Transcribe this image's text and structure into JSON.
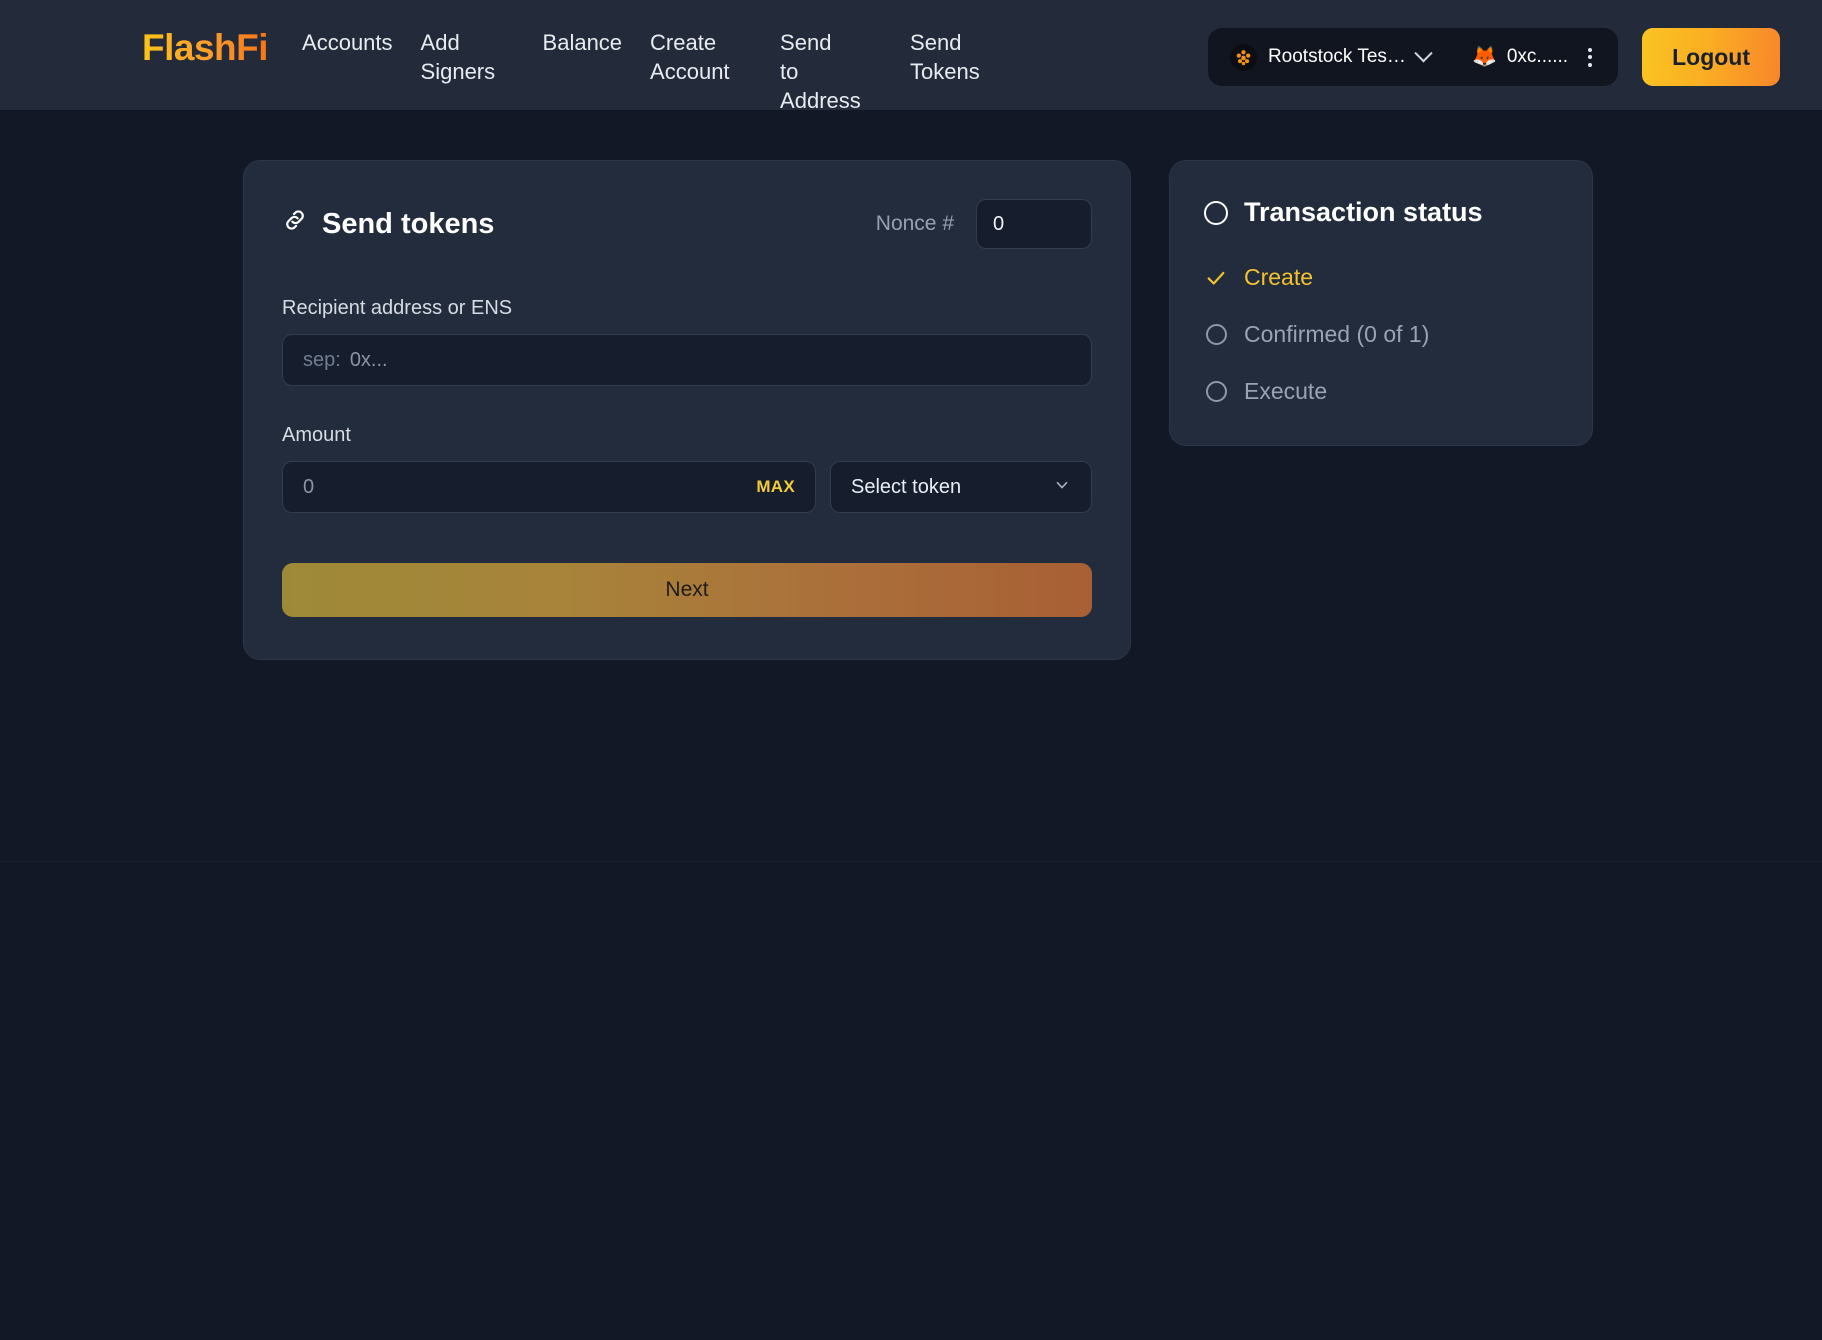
{
  "brand": {
    "name": "FlashFi"
  },
  "nav": {
    "items": [
      {
        "label": "Accounts",
        "name": "nav-item-accounts"
      },
      {
        "label": "Add Signers",
        "name": "nav-item-add-signers"
      },
      {
        "label": "Balance",
        "name": "nav-item-balance"
      },
      {
        "label": "Create Account",
        "name": "nav-item-create-account"
      },
      {
        "label": "Send to Address",
        "name": "nav-item-send-to-address"
      },
      {
        "label": "Send Tokens",
        "name": "nav-item-send-tokens"
      }
    ]
  },
  "wallet": {
    "chain_name": "Rootstock Tes…",
    "chain_icon": "rootstock-icon",
    "account_address": "0xc......",
    "account_icon": "metamask-fox-icon",
    "menu_icon": "kebab-menu-icon"
  },
  "logout": {
    "label": "Logout"
  },
  "send_card": {
    "title": "Send tokens",
    "title_icon": "link-chain-icon",
    "nonce_label": "Nonce #",
    "nonce_value": "0",
    "recipient_label": "Recipient address or ENS",
    "recipient_prefix": "sep:",
    "recipient_placeholder": "0x...",
    "recipient_value": "",
    "amount_label": "Amount",
    "amount_placeholder": "0",
    "amount_value": "",
    "max_label": "MAX",
    "token_select_label": "Select token",
    "token_chevron_icon": "chevron-down-icon",
    "next_label": "Next"
  },
  "status_panel": {
    "title": "Transaction status",
    "title_icon": "circle-outline-icon",
    "steps": [
      {
        "label": "Create",
        "state": "done",
        "icon": "check-icon"
      },
      {
        "label": "Confirmed (0 of 1)",
        "state": "pending",
        "icon": "circle-outline-icon"
      },
      {
        "label": "Execute",
        "state": "pending",
        "icon": "circle-outline-icon"
      }
    ]
  },
  "colors": {
    "brand_gradient_start": "#fcc419",
    "brand_gradient_end": "#f87414",
    "accent_gold": "#f2c230",
    "page_bg": "#121826",
    "navbar_bg": "#232b3b",
    "card_bg": "#232c3c",
    "input_bg": "#161e2d"
  }
}
